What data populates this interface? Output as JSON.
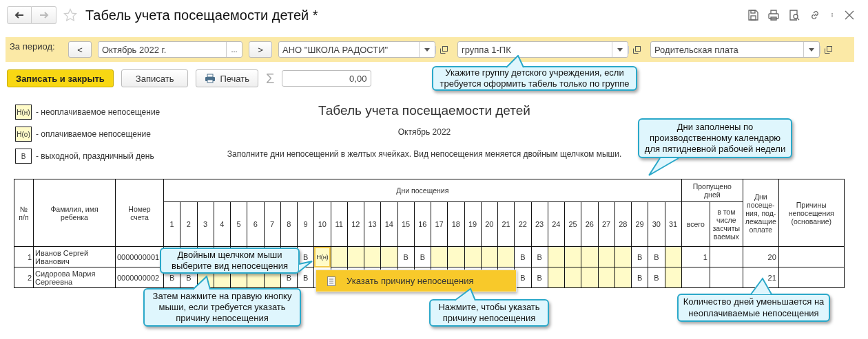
{
  "window": {
    "title": "Табель учета посещаемости детей *"
  },
  "filter": {
    "label": "За период:",
    "prev": "<",
    "period": "Октябрь 2022 г.",
    "select": "...",
    "next": ">",
    "organization": "АНО \"ШКОЛА РАДОСТИ\"",
    "group": "группа 1-ПК",
    "payment": "Родительская плата"
  },
  "actions": {
    "save_close": "Записать и закрыть",
    "save": "Записать",
    "print": "Печать",
    "sigma": "Σ",
    "total": "0,00"
  },
  "legend": [
    {
      "code": "Н(н)",
      "kind": "absence",
      "text": "- неоплачиваемое непосещение"
    },
    {
      "code": "Н(о)",
      "kind": "absence",
      "text": "- оплачиваемое непосещение"
    },
    {
      "code": "В",
      "kind": "off",
      "text": "- выходной, праздничный день"
    }
  ],
  "report": {
    "title": "Табель учета посещаемости детей",
    "period": "Октябрь 2022",
    "hint": "Заполните дни непосещений в желтых ячейках. Вид непосещения меняется двойным щелчком мыши."
  },
  "table": {
    "number": "№\nп/п",
    "name": "Фамилия, имя\nребенка",
    "account": "Номер\nсчета",
    "days_group": "Дни посещения",
    "days": [
      "1",
      "2",
      "3",
      "4",
      "5",
      "6",
      "7",
      "8",
      "9",
      "10",
      "11",
      "12",
      "13",
      "14",
      "15",
      "16",
      "17",
      "18",
      "19",
      "20",
      "21",
      "22",
      "23",
      "24",
      "25",
      "26",
      "27",
      "28",
      "29",
      "30",
      "31"
    ],
    "missed_group": "Пропущено\nдней",
    "missed_total": "всего",
    "missed_excused": "в том\nчисле\nзасчиты\nваемых",
    "paid_days": "Дни\nпосеще-\nния, под-\nлежащие\nоплате",
    "reasons": "Причины\nнепосещения\n(основание)",
    "rows": [
      {
        "number": "1",
        "name": "Иванов Сергей Иванович",
        "account": "0000000001",
        "missed": "1",
        "paid": "20",
        "days": [
          {
            "kind": "covered"
          },
          {
            "kind": "covered"
          },
          {
            "kind": "covered"
          },
          {
            "kind": "covered"
          },
          {
            "kind": "covered"
          },
          {
            "kind": "covered"
          },
          {
            "kind": "covered"
          },
          {
            "kind": "covered"
          },
          {
            "kind": "off",
            "text": "В",
            "selected": false
          },
          {
            "kind": "work",
            "text": "Н(н)",
            "selected": true
          },
          {
            "kind": "work",
            "selected": false
          },
          {
            "kind": "work",
            "selected": false
          },
          {
            "kind": "work",
            "selected": false
          },
          {
            "kind": "work",
            "selected": false
          },
          {
            "kind": "off",
            "text": "В",
            "selected": false
          },
          {
            "kind": "off",
            "text": "В",
            "selected": false
          },
          {
            "kind": "work",
            "selected": false
          },
          {
            "kind": "work",
            "selected": false
          },
          {
            "kind": "work",
            "selected": false
          },
          {
            "kind": "work",
            "selected": false
          },
          {
            "kind": "work",
            "selected": false
          },
          {
            "kind": "off",
            "text": "В",
            "selected": false
          },
          {
            "kind": "off",
            "text": "В",
            "selected": false
          },
          {
            "kind": "work",
            "selected": false
          },
          {
            "kind": "work",
            "selected": false
          },
          {
            "kind": "work",
            "selected": false
          },
          {
            "kind": "work",
            "selected": false
          },
          {
            "kind": "work",
            "selected": false
          },
          {
            "kind": "off",
            "text": "В",
            "selected": false
          },
          {
            "kind": "off",
            "text": "В",
            "selected": false
          },
          {
            "kind": "work",
            "selected": false
          }
        ]
      },
      {
        "number": "2",
        "name": "Сидорова Мария Сергеевна",
        "account": "0000000002",
        "paid": "21",
        "days": [
          {
            "kind": "off",
            "text": "В",
            "selected": false
          },
          {
            "kind": "off",
            "text": "В",
            "selected": false
          },
          {
            "kind": "work",
            "selected": false
          },
          {
            "kind": "work",
            "selected": false
          },
          {
            "kind": "work",
            "selected": false
          },
          {
            "kind": "work",
            "selected": false
          },
          {
            "kind": "work",
            "selected": false
          },
          {
            "kind": "off",
            "text": "В",
            "selected": false
          },
          {
            "kind": "off",
            "text": "В",
            "selected": false
          },
          {
            "kind": "covered"
          },
          {
            "kind": "covered"
          },
          {
            "kind": "covered"
          },
          {
            "kind": "covered"
          },
          {
            "kind": "covered"
          },
          {
            "kind": "covered"
          },
          {
            "kind": "covered"
          },
          {
            "kind": "covered"
          },
          {
            "kind": "covered"
          },
          {
            "kind": "covered"
          },
          {
            "kind": "covered"
          },
          {
            "kind": "covered"
          },
          {
            "kind": "off",
            "text": "В",
            "selected": false
          },
          {
            "kind": "off",
            "text": "В",
            "selected": false
          },
          {
            "kind": "work",
            "selected": false
          },
          {
            "kind": "work",
            "selected": false
          },
          {
            "kind": "work",
            "selected": false
          },
          {
            "kind": "work",
            "selected": false
          },
          {
            "kind": "work",
            "selected": false
          },
          {
            "kind": "off",
            "text": "В",
            "selected": false
          },
          {
            "kind": "off",
            "text": "В",
            "selected": false
          },
          {
            "kind": "work",
            "selected": false
          }
        ]
      }
    ]
  },
  "context_menu": {
    "item": "Указать причину непосещения"
  },
  "callouts": [
    {
      "text": "Укажите группу детского учреждения, если\nтребуется оформить табель только по группе"
    },
    {
      "text": "Дни заполнены по\nпроизводственному календарю\nдля пятидневной рабочей недели"
    },
    {
      "text": "Двойным щелчком мыши\nвыберите вид непосещения"
    },
    {
      "text": "Затем нажмите на правую кнопку\nмыши, если требуется указать\nпричину непосещения"
    },
    {
      "text": "Количество дней уменьшается на\nнеоплачиваемые непосещения"
    },
    {
      "text": "Нажмите, чтобы указать\nпричину непосещения"
    }
  ]
}
